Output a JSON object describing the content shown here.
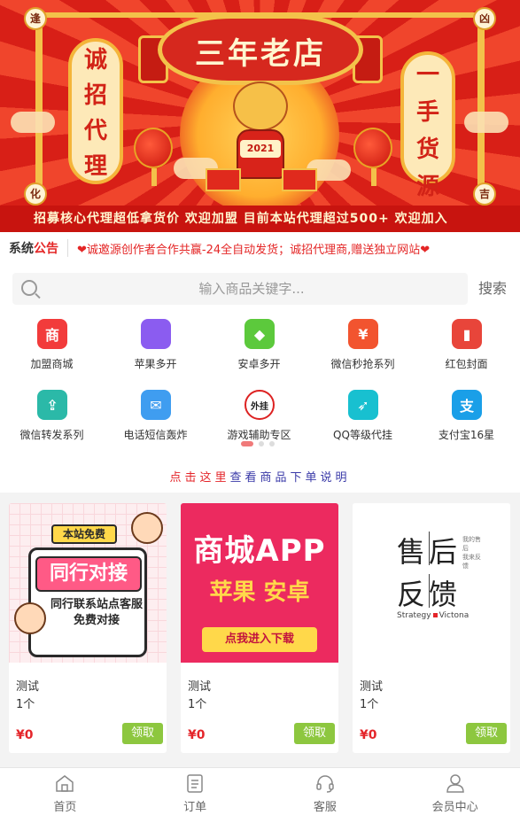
{
  "banner": {
    "scroll_title": "三年老店",
    "left_vertical": [
      "诚",
      "招",
      "代",
      "理"
    ],
    "right_vertical": [
      "一",
      "手",
      "货",
      "源"
    ],
    "corners": [
      "逢",
      "凶",
      "化",
      "吉"
    ],
    "ox_sign": "2021",
    "footer": "招募核心代理超低拿货价  欢迎加盟  目前本站代理超过500+  欢迎加入"
  },
  "notice": {
    "tag_a": "系统",
    "tag_b": "公告",
    "text": "❤诚邀源创作者合作共赢-24全自动发货；诚招代理商,赠送独立网站❤"
  },
  "search": {
    "placeholder": "输入商品关键字...",
    "button": "搜索"
  },
  "categories": [
    {
      "label": "加盟商城",
      "icon": "shop-icon",
      "glyph": "商",
      "color": "#f23b3b"
    },
    {
      "label": "苹果多开",
      "icon": "apple-icon",
      "glyph": "",
      "color": "#8b5cf0"
    },
    {
      "label": "安卓多开",
      "icon": "android-icon",
      "glyph": "◆",
      "color": "#5cc93c"
    },
    {
      "label": "微信秒抢系列",
      "icon": "red-packet-icon",
      "glyph": "¥",
      "color": "#f2542f"
    },
    {
      "label": "红包封面",
      "icon": "phone-cover-icon",
      "glyph": "▮",
      "color": "#e8453a"
    },
    {
      "label": "微信转发系列",
      "icon": "share-icon",
      "glyph": "⇪",
      "color": "#2bb9a8"
    },
    {
      "label": "电话短信轰炸",
      "icon": "mail-icon",
      "glyph": "✉",
      "color": "#3f9df0"
    },
    {
      "label": "游戏辅助专区",
      "icon": "no-cheat-icon",
      "glyph": "外挂",
      "color": "#fff"
    },
    {
      "label": "QQ等级代挂",
      "icon": "rocket-icon",
      "glyph": "➶",
      "color": "#18c0d0"
    },
    {
      "label": "支付宝16星",
      "icon": "alipay-wechat-icon",
      "glyph": "支",
      "color": "#1a9fe8"
    }
  ],
  "guide": {
    "part_a": "点击这里",
    "part_b": "查看商品下单说明"
  },
  "products": [
    {
      "name": "测试",
      "qty": "1个",
      "price": "¥0",
      "button": "领取",
      "img_ribbon": "本站免费",
      "img_big": "同行对接",
      "img_sub": "同行联系站点客服 免费对接"
    },
    {
      "name": "测试",
      "qty": "1个",
      "price": "¥0",
      "button": "领取",
      "img_t1": "商城APP",
      "img_t2": "苹果 安卓",
      "img_dl": "点我进入下载"
    },
    {
      "name": "测试",
      "qty": "1个",
      "price": "¥0",
      "button": "领取",
      "img_r1": "售后",
      "img_r2": "反馈",
      "img_small_a": "我的售后",
      "img_small_b": "我来反馈",
      "img_foot_a": "Strategy",
      "img_foot_b": "Victona"
    }
  ],
  "tabbar": [
    {
      "label": "首页",
      "icon": "home-icon"
    },
    {
      "label": "订单",
      "icon": "order-list-icon"
    },
    {
      "label": "客服",
      "icon": "headset-icon"
    },
    {
      "label": "会员中心",
      "icon": "user-icon"
    }
  ],
  "colors": {
    "accent_red": "#e4252a",
    "button_green": "#8dc73f",
    "guide_blue": "#3a3aa8"
  }
}
